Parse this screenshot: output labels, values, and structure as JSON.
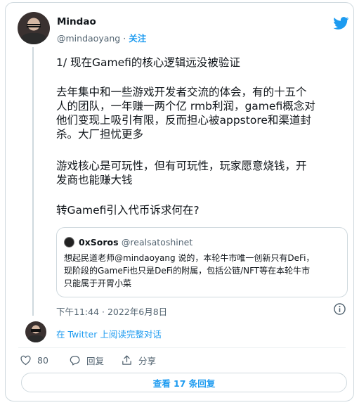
{
  "author": {
    "name": "Mindao",
    "handle": "@mindaoyang",
    "separator": "·",
    "follow_label": "关注"
  },
  "tweet": {
    "paragraphs": [
      [
        "1/ 现在Gamefi的核心逻辑远没被验证"
      ],
      [
        "去年集中和一些游戏开发者交流的体会，有的十五个",
        "人的团队，一年赚一两个亿 rmb利润，gamefi概念对",
        "他们变现上吸引有限，反而担心被appstore和渠道封",
        "杀。大厂担忧更多"
      ],
      [
        "游戏核心是可玩性，但有可玩性，玩家愿意烧钱，开",
        "发商也能赚大钱"
      ],
      [
        "转Gamefi引入代币诉求何在?"
      ]
    ],
    "timestamp": "下午11:44 · 2022年6月8日"
  },
  "quote": {
    "name": "0xSoros",
    "handle": "@realsatoshinet",
    "lines": [
      "想起民道老师@mindaoyang 说的，本轮牛市唯一创新只有DeFi，",
      "现阶段的GameFi也只是DeFi的附属，包括公链/NFT等在本轮牛市",
      "只能属于开胃小菜"
    ]
  },
  "footer": {
    "read_link": "在 Twitter 上阅读完整对话",
    "like_count": "80",
    "reply_label": "回复",
    "share_label": "分享",
    "view_replies_label": "查看 17 条回复"
  },
  "colors": {
    "accent": "#1d9bf0",
    "text": "#0f1419",
    "muted": "#536471",
    "border": "#cfd9de"
  },
  "icons": [
    "twitter-bird-icon",
    "info-icon",
    "heart-icon",
    "reply-bubble-icon",
    "share-icon"
  ]
}
